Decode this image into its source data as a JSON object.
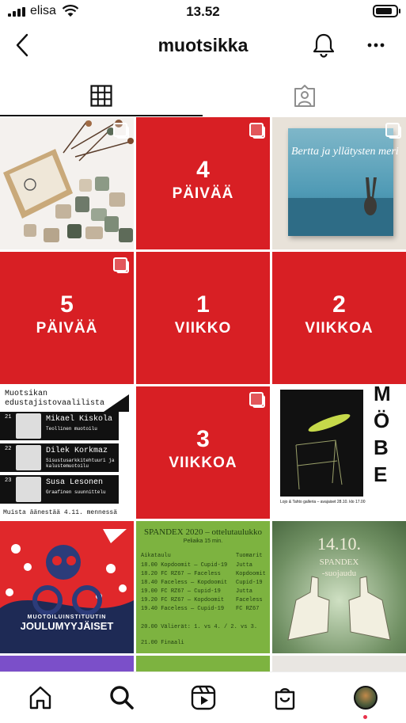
{
  "status_bar": {
    "carrier": "elisa",
    "time": "13.52",
    "battery_level": 0.85
  },
  "header": {
    "title": "muotsikka",
    "icons": {
      "back": "chevron-left-icon",
      "notifications": "bell-icon",
      "more": "more-horizontal-icon"
    }
  },
  "tabs": {
    "grid": "grid-icon",
    "tagged": "tagged-user-icon",
    "active": "grid"
  },
  "posts": {
    "p2": {
      "number": "4",
      "unit": "PÄIVÄÄ"
    },
    "p3": {
      "title": "Bertta ja yllätysten meri"
    },
    "p4": {
      "number": "5",
      "unit": "PÄIVÄÄ"
    },
    "p5": {
      "number": "1",
      "unit": "VIIKKO"
    },
    "p6": {
      "number": "2",
      "unit": "VIIKKOA"
    },
    "p7": {
      "title_line1": "Muotsikan",
      "title_line2": "edustajistovaalilista",
      "candidates": [
        {
          "number": "21",
          "name": "Mikael Kiskola",
          "role": "Teollinen muotoilu"
        },
        {
          "number": "22",
          "name": "Dilek Korkmaz",
          "role": "Sisustusarkkitehtuuri ja kalustemuotoilu"
        },
        {
          "number": "23",
          "name": "Susa Lesonen",
          "role": "Graafinen suunnittelu"
        }
      ],
      "footer": "Muista äänestää 4.11. mennessä"
    },
    "p8": {
      "letters": [
        "M",
        "Ö",
        "B",
        "E"
      ],
      "caption": "Lojo & Tahto galleria – avajaiset 28.10. klo 17.00"
    },
    "p9": {
      "title_line1": "MUOTOILUINSTITUUTIN",
      "title_line2": "JOULUMYYJÄISET"
    },
    "p10": {
      "title": "SPANDEX 2020 – ottelutaulukko",
      "subtitle": "Peliaika 15 min.",
      "column_left": "Aikataulu",
      "column_right": "Tuomarit",
      "rows": [
        {
          "time": "18.00",
          "match": "Kopdoomit — Cupid-19",
          "referee": "Jutta"
        },
        {
          "time": "18.20",
          "match": "FC RZ67 — Faceless",
          "referee": "Kopdoomit"
        },
        {
          "time": "18.40",
          "match": "Faceless — Kopdoomit",
          "referee": "Cupid-19"
        },
        {
          "time": "19.00",
          "match": "FC RZ67 — Cupid-19",
          "referee": "Jutta"
        },
        {
          "time": "19.20",
          "match": "FC RZ67 — Kopdoomit",
          "referee": "Faceless"
        },
        {
          "time": "19.40",
          "match": "Faceless — Cupid-19",
          "referee": "FC RZ67"
        }
      ],
      "break": "20.00  Välierät: 1. vs 4. / 2. vs 3.",
      "final": "21.00  Finaali"
    },
    "p11": {
      "date": "14.10.",
      "title": "SPANDEX",
      "subtitle": "-suojaudu"
    }
  },
  "bottom_nav": {
    "items": [
      "home-icon",
      "search-icon",
      "reels-icon",
      "shop-icon",
      "profile-avatar"
    ],
    "active": "search"
  },
  "colors": {
    "brand_red": "#d81f24",
    "notification_dot": "#e8324b"
  }
}
